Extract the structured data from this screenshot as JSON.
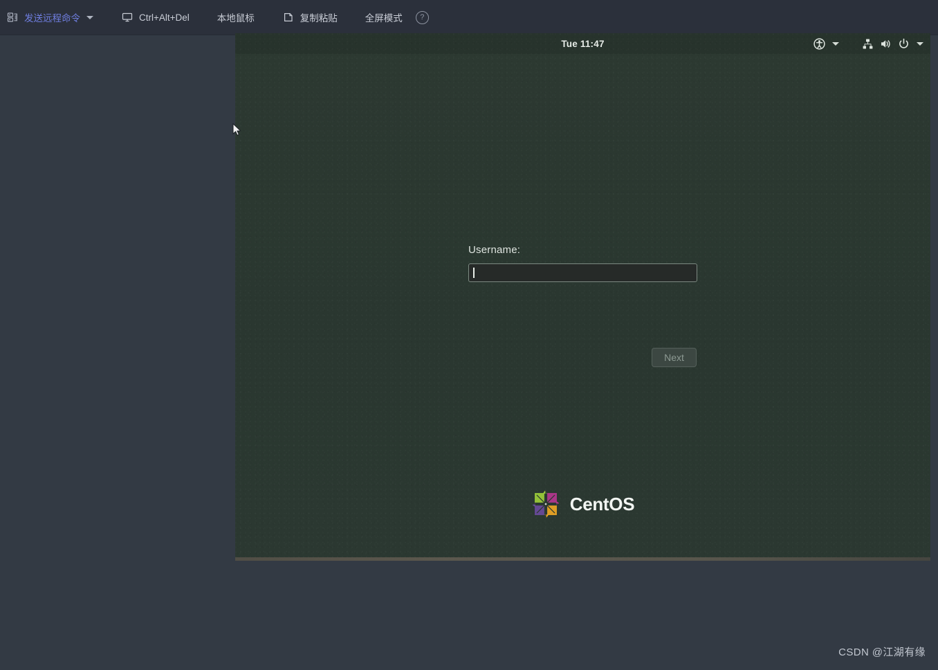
{
  "toolbar": {
    "items": [
      {
        "id": "send-remote-command",
        "label": "发送远程命令",
        "icon": "server-icon",
        "has_caret": true,
        "accent_color": "#6f7ee0"
      },
      {
        "id": "ctrl-alt-del",
        "label": "Ctrl+Alt+Del",
        "icon": "monitor-icon",
        "has_caret": false
      },
      {
        "id": "local-mouse",
        "label": "本地鼠标",
        "icon": "none",
        "has_caret": false
      },
      {
        "id": "copy-paste",
        "label": "复制粘贴",
        "icon": "clipboard-icon",
        "has_caret": false
      },
      {
        "id": "fullscreen-mode",
        "label": "全屏模式",
        "icon": "none",
        "has_caret": false
      }
    ],
    "help_label": "?"
  },
  "remote": {
    "clock": "Tue 11:47",
    "tray": [
      {
        "id": "accessibility",
        "icon": "accessibility-icon",
        "has_caret": true
      },
      {
        "id": "network",
        "icon": "network-icon",
        "has_caret": false
      },
      {
        "id": "volume",
        "icon": "volume-icon",
        "has_caret": false
      },
      {
        "id": "power",
        "icon": "power-icon",
        "has_caret": true
      }
    ],
    "login": {
      "username_label": "Username:",
      "username_value": "",
      "username_placeholder": "",
      "next_label": "Next",
      "next_disabled": true
    },
    "brand": {
      "name": "CentOS",
      "logo_colors": {
        "green": "#9ccd3a",
        "magenta": "#b5368f",
        "orange": "#efa724",
        "violet": "#6a4b9c"
      }
    },
    "background_color": "#2b3830"
  },
  "watermark": {
    "text": "CSDN @江湖有缘"
  }
}
